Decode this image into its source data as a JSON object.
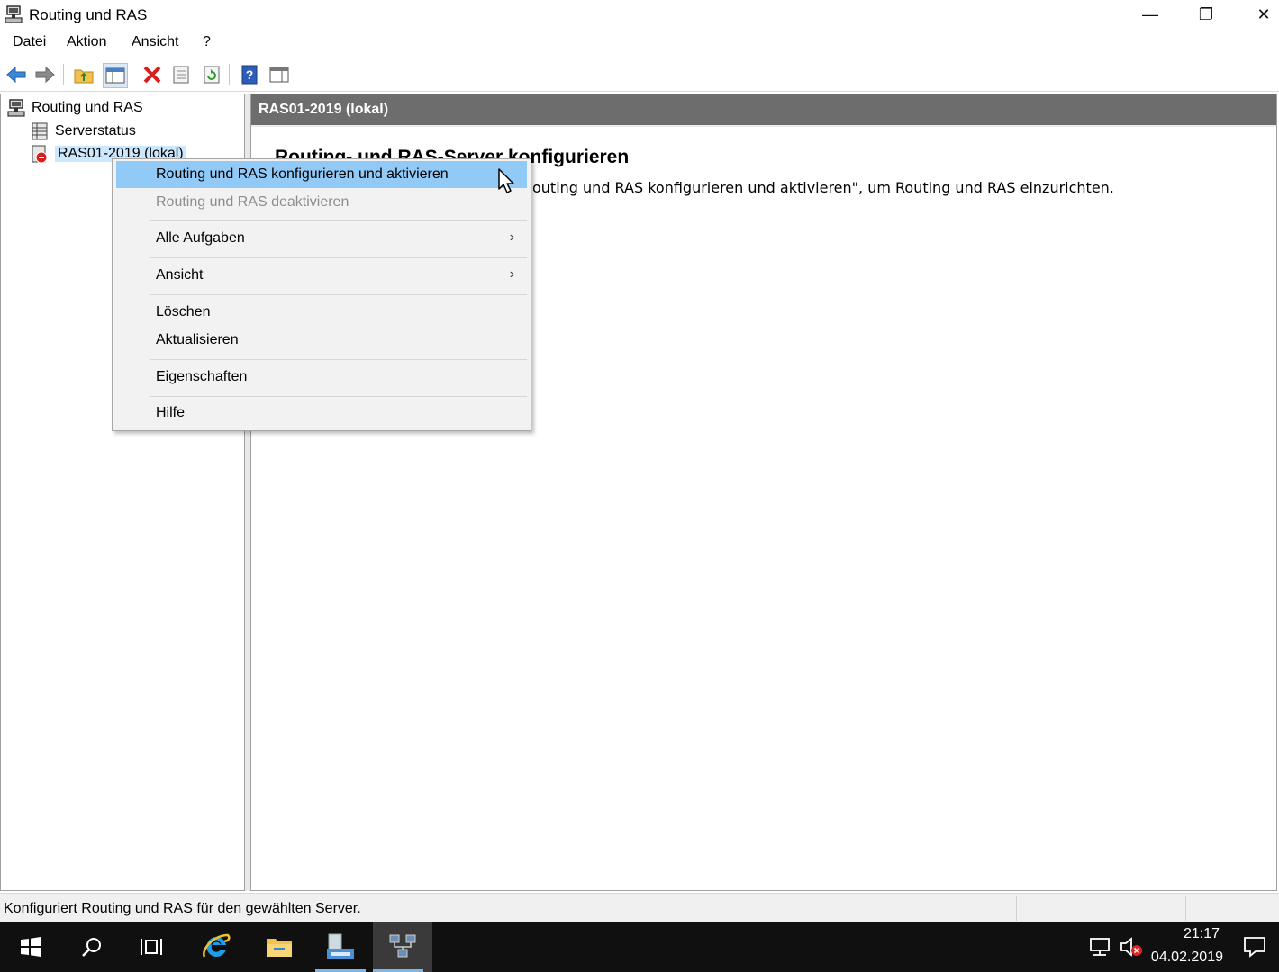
{
  "window": {
    "title": "Routing und RAS",
    "minimize": "—",
    "maximize": "❐",
    "close": "✕"
  },
  "menu": [
    "Datei",
    "Aktion",
    "Ansicht",
    "?"
  ],
  "toolbar_icons": [
    "back-arrow-icon",
    "forward-arrow-icon",
    "up-folder-icon",
    "show-hide-tree-icon",
    "delete-icon",
    "properties-icon",
    "refresh-icon",
    "help-icon",
    "show-action-pane-icon"
  ],
  "tree": {
    "root": "Routing und RAS",
    "items": [
      {
        "label": "Serverstatus"
      },
      {
        "label": "RAS01-2019 (lokal)"
      }
    ]
  },
  "rightpane": {
    "header": "RAS01-2019 (lokal)",
    "heading": "Routing- und RAS-Server konfigurieren",
    "text": "outing und RAS konfigurieren und aktivieren\", um Routing und RAS einzurichten."
  },
  "context_menu": {
    "configure": "Routing und RAS konfigurieren und aktivieren",
    "deactivate": "Routing und RAS deaktivieren",
    "all_tasks": "Alle Aufgaben",
    "view": "Ansicht",
    "delete": "Löschen",
    "refresh": "Aktualisieren",
    "properties": "Eigenschaften",
    "help": "Hilfe",
    "submenu_arrow": "›"
  },
  "statusbar": {
    "text": "Konfiguriert Routing und RAS für den gewählten Server."
  },
  "taskbar": {
    "time": "21:17",
    "date": "04.02.2019"
  },
  "colors": {
    "menu_highlight": "#91c9f7",
    "tree_selection": "#cce8ff",
    "pane_header": "#6d6d6d",
    "taskbar": "#101010"
  }
}
